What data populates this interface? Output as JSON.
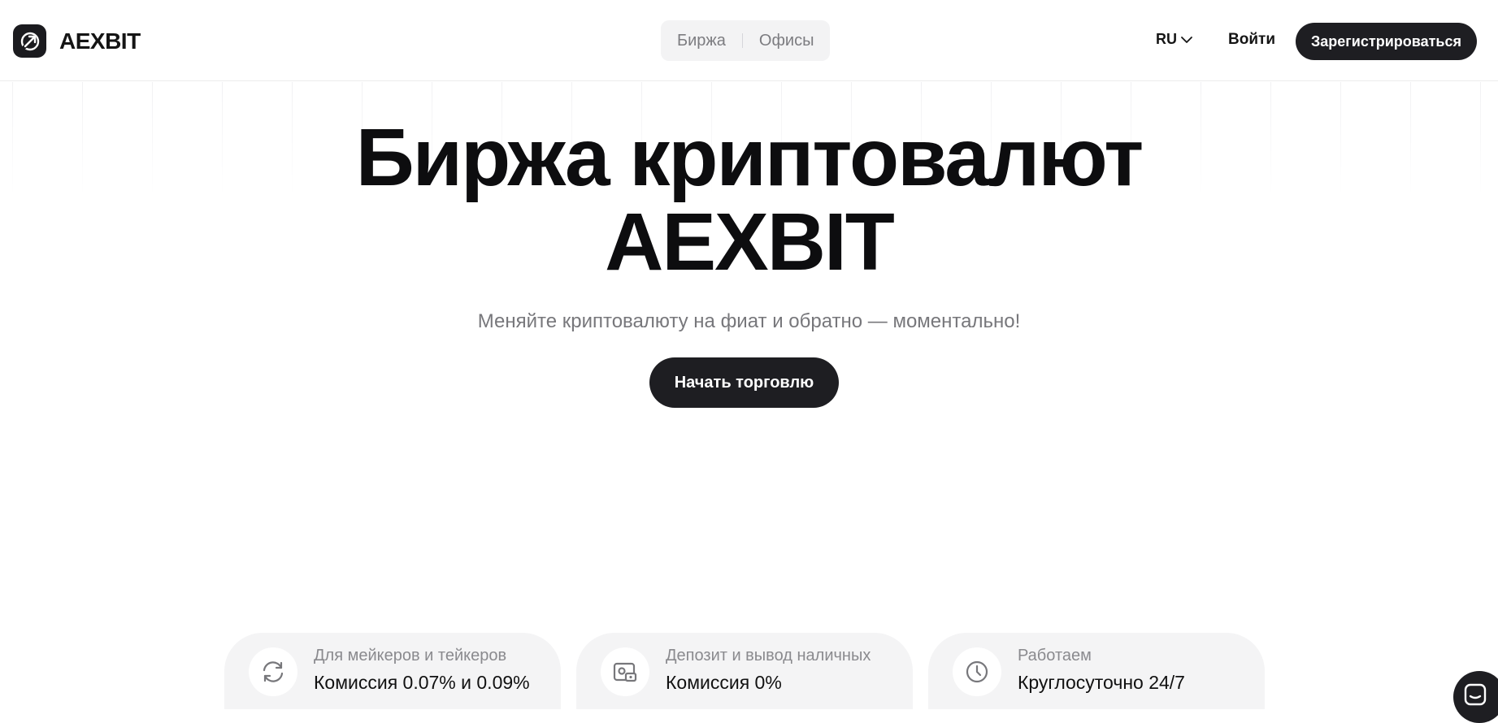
{
  "header": {
    "brand": "AEXBIT",
    "nav": [
      "Биржа",
      "Офисы"
    ],
    "language": "RU",
    "login_label": "Войти",
    "register_label": "Зарегистрироваться"
  },
  "hero": {
    "title_line1": "Биржа криптовалют",
    "title_line2": "AEXBIT",
    "subtitle": "Меняйте криптовалюту на фиат и обратно — моментально!",
    "cta_label": "Начать торговлю"
  },
  "features": [
    {
      "label": "Для мейкеров и тейкеров",
      "value": "Комиссия 0.07% и 0.09%",
      "icon": "refresh-icon"
    },
    {
      "label": "Депозит и вывод наличных",
      "value": "Комиссия 0%",
      "icon": "cash-icon"
    },
    {
      "label": "Работаем",
      "value": "Круглосуточно 24/7",
      "icon": "clock-icon"
    }
  ],
  "colors": {
    "primary_dark": "#1e1e22",
    "muted_text": "#77777b",
    "card_bg": "#f4f4f5",
    "segmented_bg": "#f3f3f4"
  }
}
